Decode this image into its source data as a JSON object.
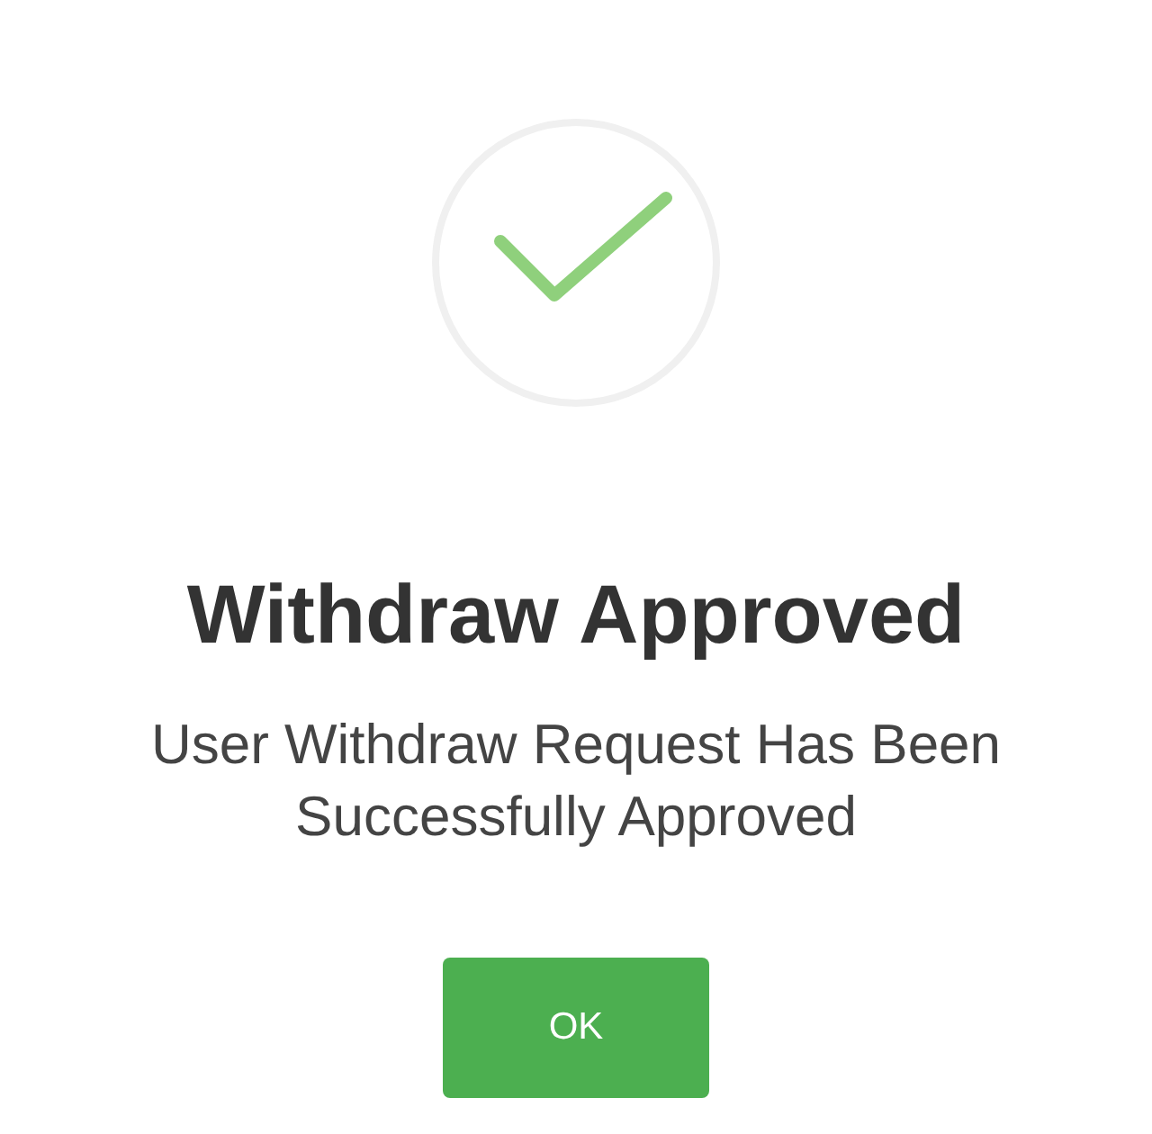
{
  "dialog": {
    "title": "Withdraw Approved",
    "message": "User Withdraw Request Has Been Successfully Approved",
    "buttons": [
      "OK"
    ]
  }
}
